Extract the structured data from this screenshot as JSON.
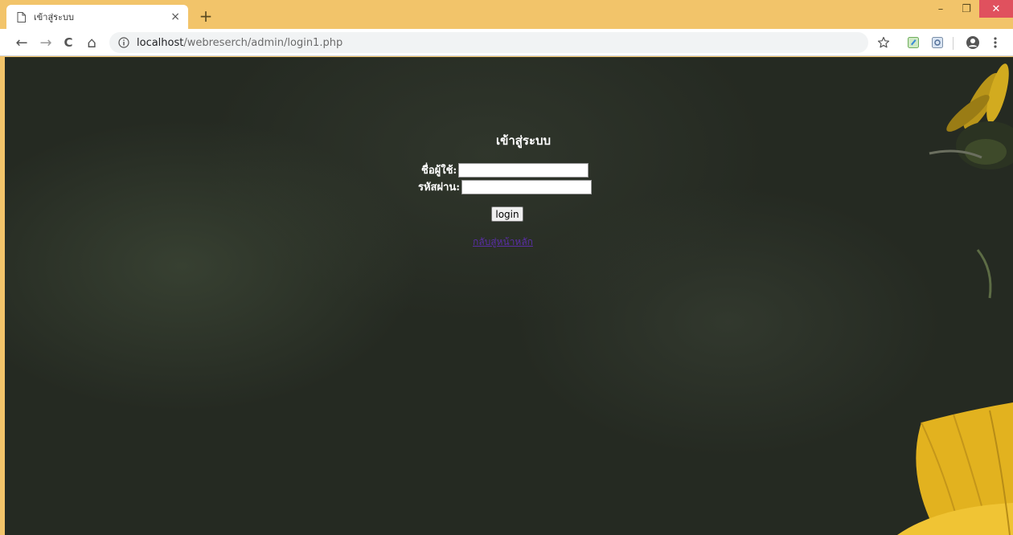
{
  "browser": {
    "tab_title": "เข้าสู่ระบบ",
    "close_tab_symbol": "×",
    "new_tab_symbol": "+",
    "window_controls": {
      "minimize": "–",
      "maximize": "❐",
      "close": "✕"
    },
    "nav": {
      "back": "←",
      "forward": "→",
      "reload": "C",
      "home": "⌂"
    },
    "url_host": "localhost",
    "url_path": "/webreserch/admin/login1.php",
    "icons": [
      "page-icon",
      "info-icon",
      "star-icon",
      "extension-icon",
      "extension-icon",
      "profile-icon",
      "menu-icon"
    ]
  },
  "login": {
    "heading": "เข้าสู่ระบบ",
    "username_label": "ชื่อผู้ใช้:",
    "password_label": "รหัสผ่าน:",
    "username_value": "",
    "password_value": "",
    "submit_label": "login",
    "back_link": "กลับสู่หน้าหลัก"
  },
  "colors": {
    "tabbar": "#f2c46a",
    "page_background": "#252a22",
    "link": "#5a2ea6",
    "flower": "#e2b21f"
  }
}
